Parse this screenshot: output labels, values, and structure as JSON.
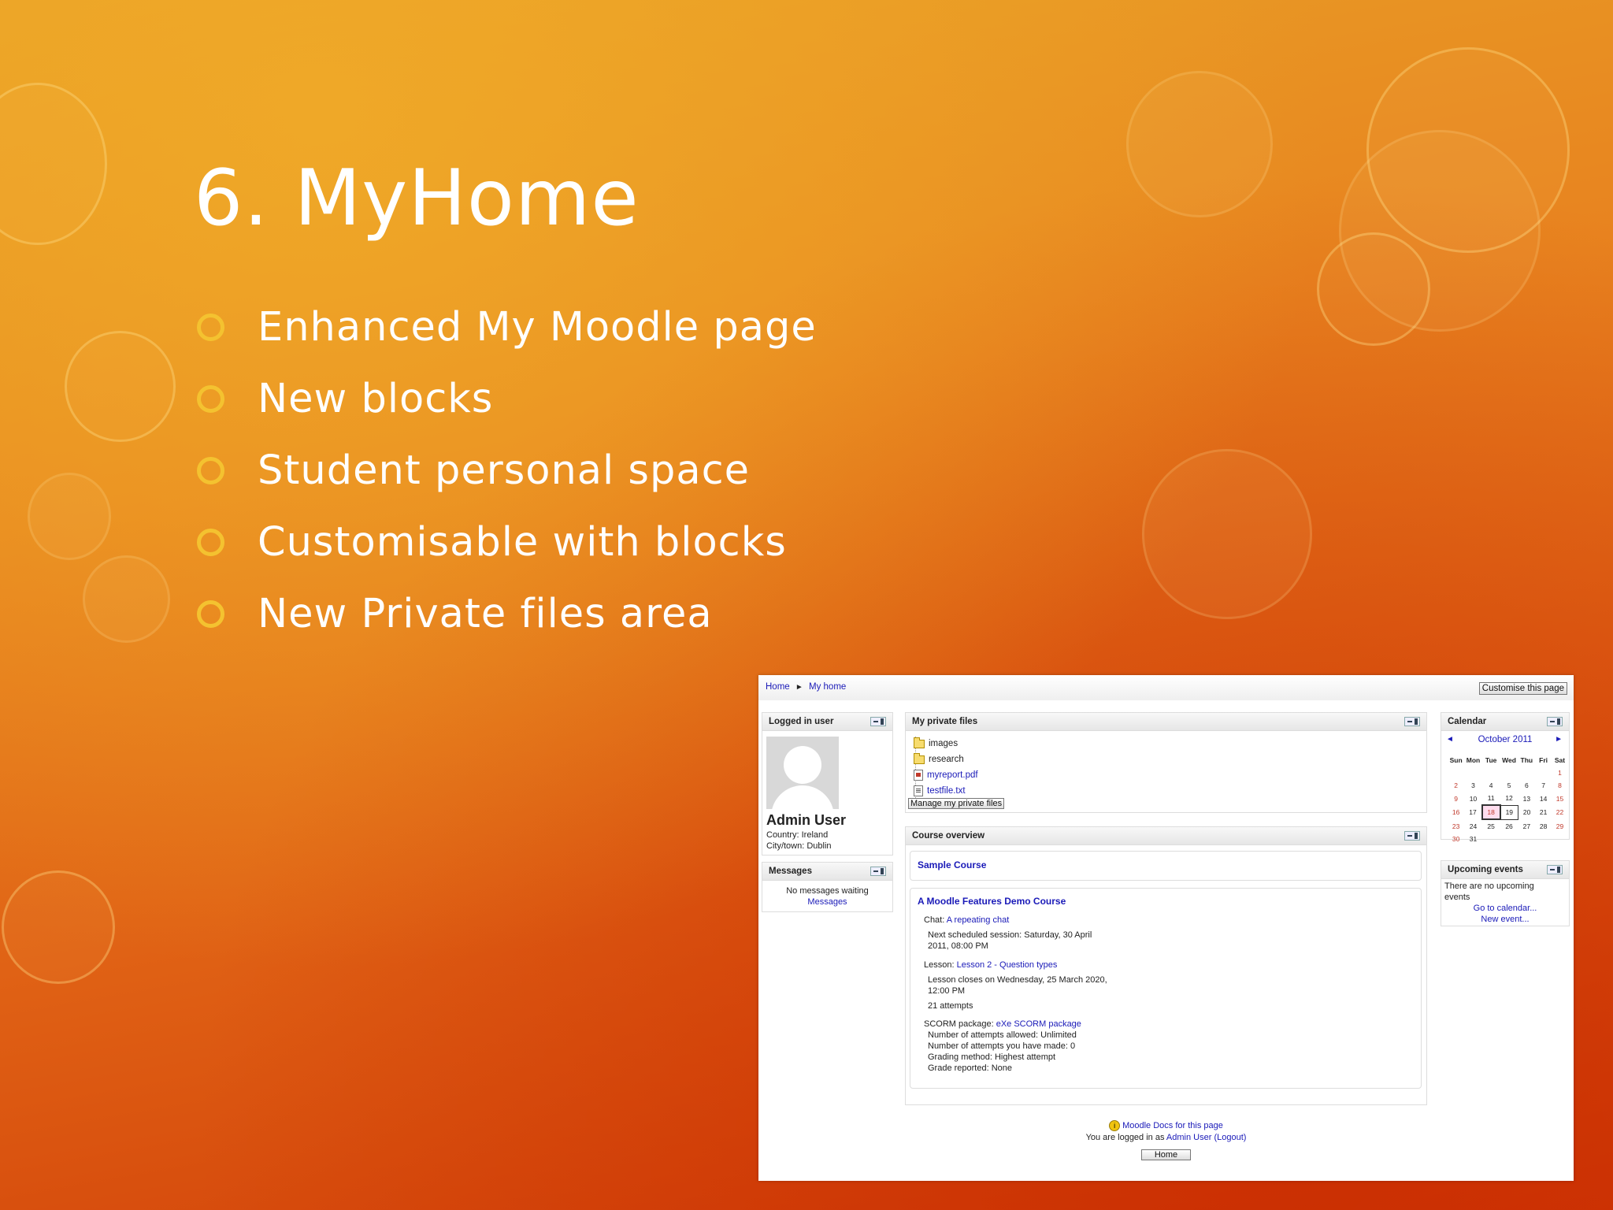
{
  "slide": {
    "title": "6. MyHome",
    "bullets": [
      "Enhanced My Moodle page",
      "New blocks",
      "Student personal space",
      "Customisable with blocks",
      "New Private files area"
    ]
  },
  "moodle": {
    "breadcrumb": {
      "home": "Home",
      "sep": "►",
      "current": "My home"
    },
    "customise_button": "Customise this page",
    "logged_in_user": {
      "header": "Logged in user",
      "name": "Admin User",
      "country": "Country: Ireland",
      "city": "City/town: Dublin"
    },
    "messages": {
      "header": "Messages",
      "text": "No messages waiting",
      "link": "Messages"
    },
    "private_files": {
      "header": "My private files",
      "items": [
        {
          "name": "images",
          "type": "folder"
        },
        {
          "name": "research",
          "type": "folder"
        },
        {
          "name": "myreport.pdf",
          "type": "pdf"
        },
        {
          "name": "testfile.txt",
          "type": "txt"
        }
      ],
      "manage_button": "Manage my private files"
    },
    "course_overview": {
      "header": "Course overview",
      "course1": "Sample Course",
      "course2": {
        "title": "A Moodle Features Demo Course",
        "chat_label": "Chat: ",
        "chat_link": "A repeating chat",
        "chat_line1": "Next scheduled session: Saturday, 30 April",
        "chat_line2": "2011, 08:00 PM",
        "lesson_label": "Lesson: ",
        "lesson_link": "Lesson 2 - Question types",
        "lesson_line1": "Lesson closes on Wednesday, 25 March 2020,",
        "lesson_line2": "12:00 PM",
        "lesson_line3": "21 attempts",
        "scorm_label": "SCORM package: ",
        "scorm_link": "eXe SCORM package",
        "scorm_lines": [
          "Number of attempts allowed: Unlimited",
          "Number of attempts you have made: 0",
          "Grading method: Highest attempt",
          "Grade reported: None"
        ]
      }
    },
    "calendar": {
      "header": "Calendar",
      "prev": "◄",
      "next": "►",
      "month": "October 2011",
      "days": [
        "Sun",
        "Mon",
        "Tue",
        "Wed",
        "Thu",
        "Fri",
        "Sat"
      ],
      "weeks": [
        [
          "",
          "",
          "",
          "",
          "",
          "",
          "1"
        ],
        [
          "2",
          "3",
          "4",
          "5",
          "6",
          "7",
          "8"
        ],
        [
          "9",
          "10",
          "11",
          "12",
          "13",
          "14",
          "15"
        ],
        [
          "16",
          "17",
          "18",
          "19",
          "20",
          "21",
          "22"
        ],
        [
          "23",
          "24",
          "25",
          "26",
          "27",
          "28",
          "29"
        ],
        [
          "30",
          "31",
          "",
          "",
          "",
          "",
          ""
        ]
      ],
      "today": "18"
    },
    "upcoming_events": {
      "header": "Upcoming events",
      "text": "There are no upcoming events",
      "link1": "Go to calendar...",
      "link2": "New event..."
    },
    "footer": {
      "docs_link": "Moodle Docs for this page",
      "logged_in_prefix": "You are logged in as ",
      "user_link": "Admin User",
      "logout": "(Logout)",
      "home_button": "Home"
    }
  }
}
